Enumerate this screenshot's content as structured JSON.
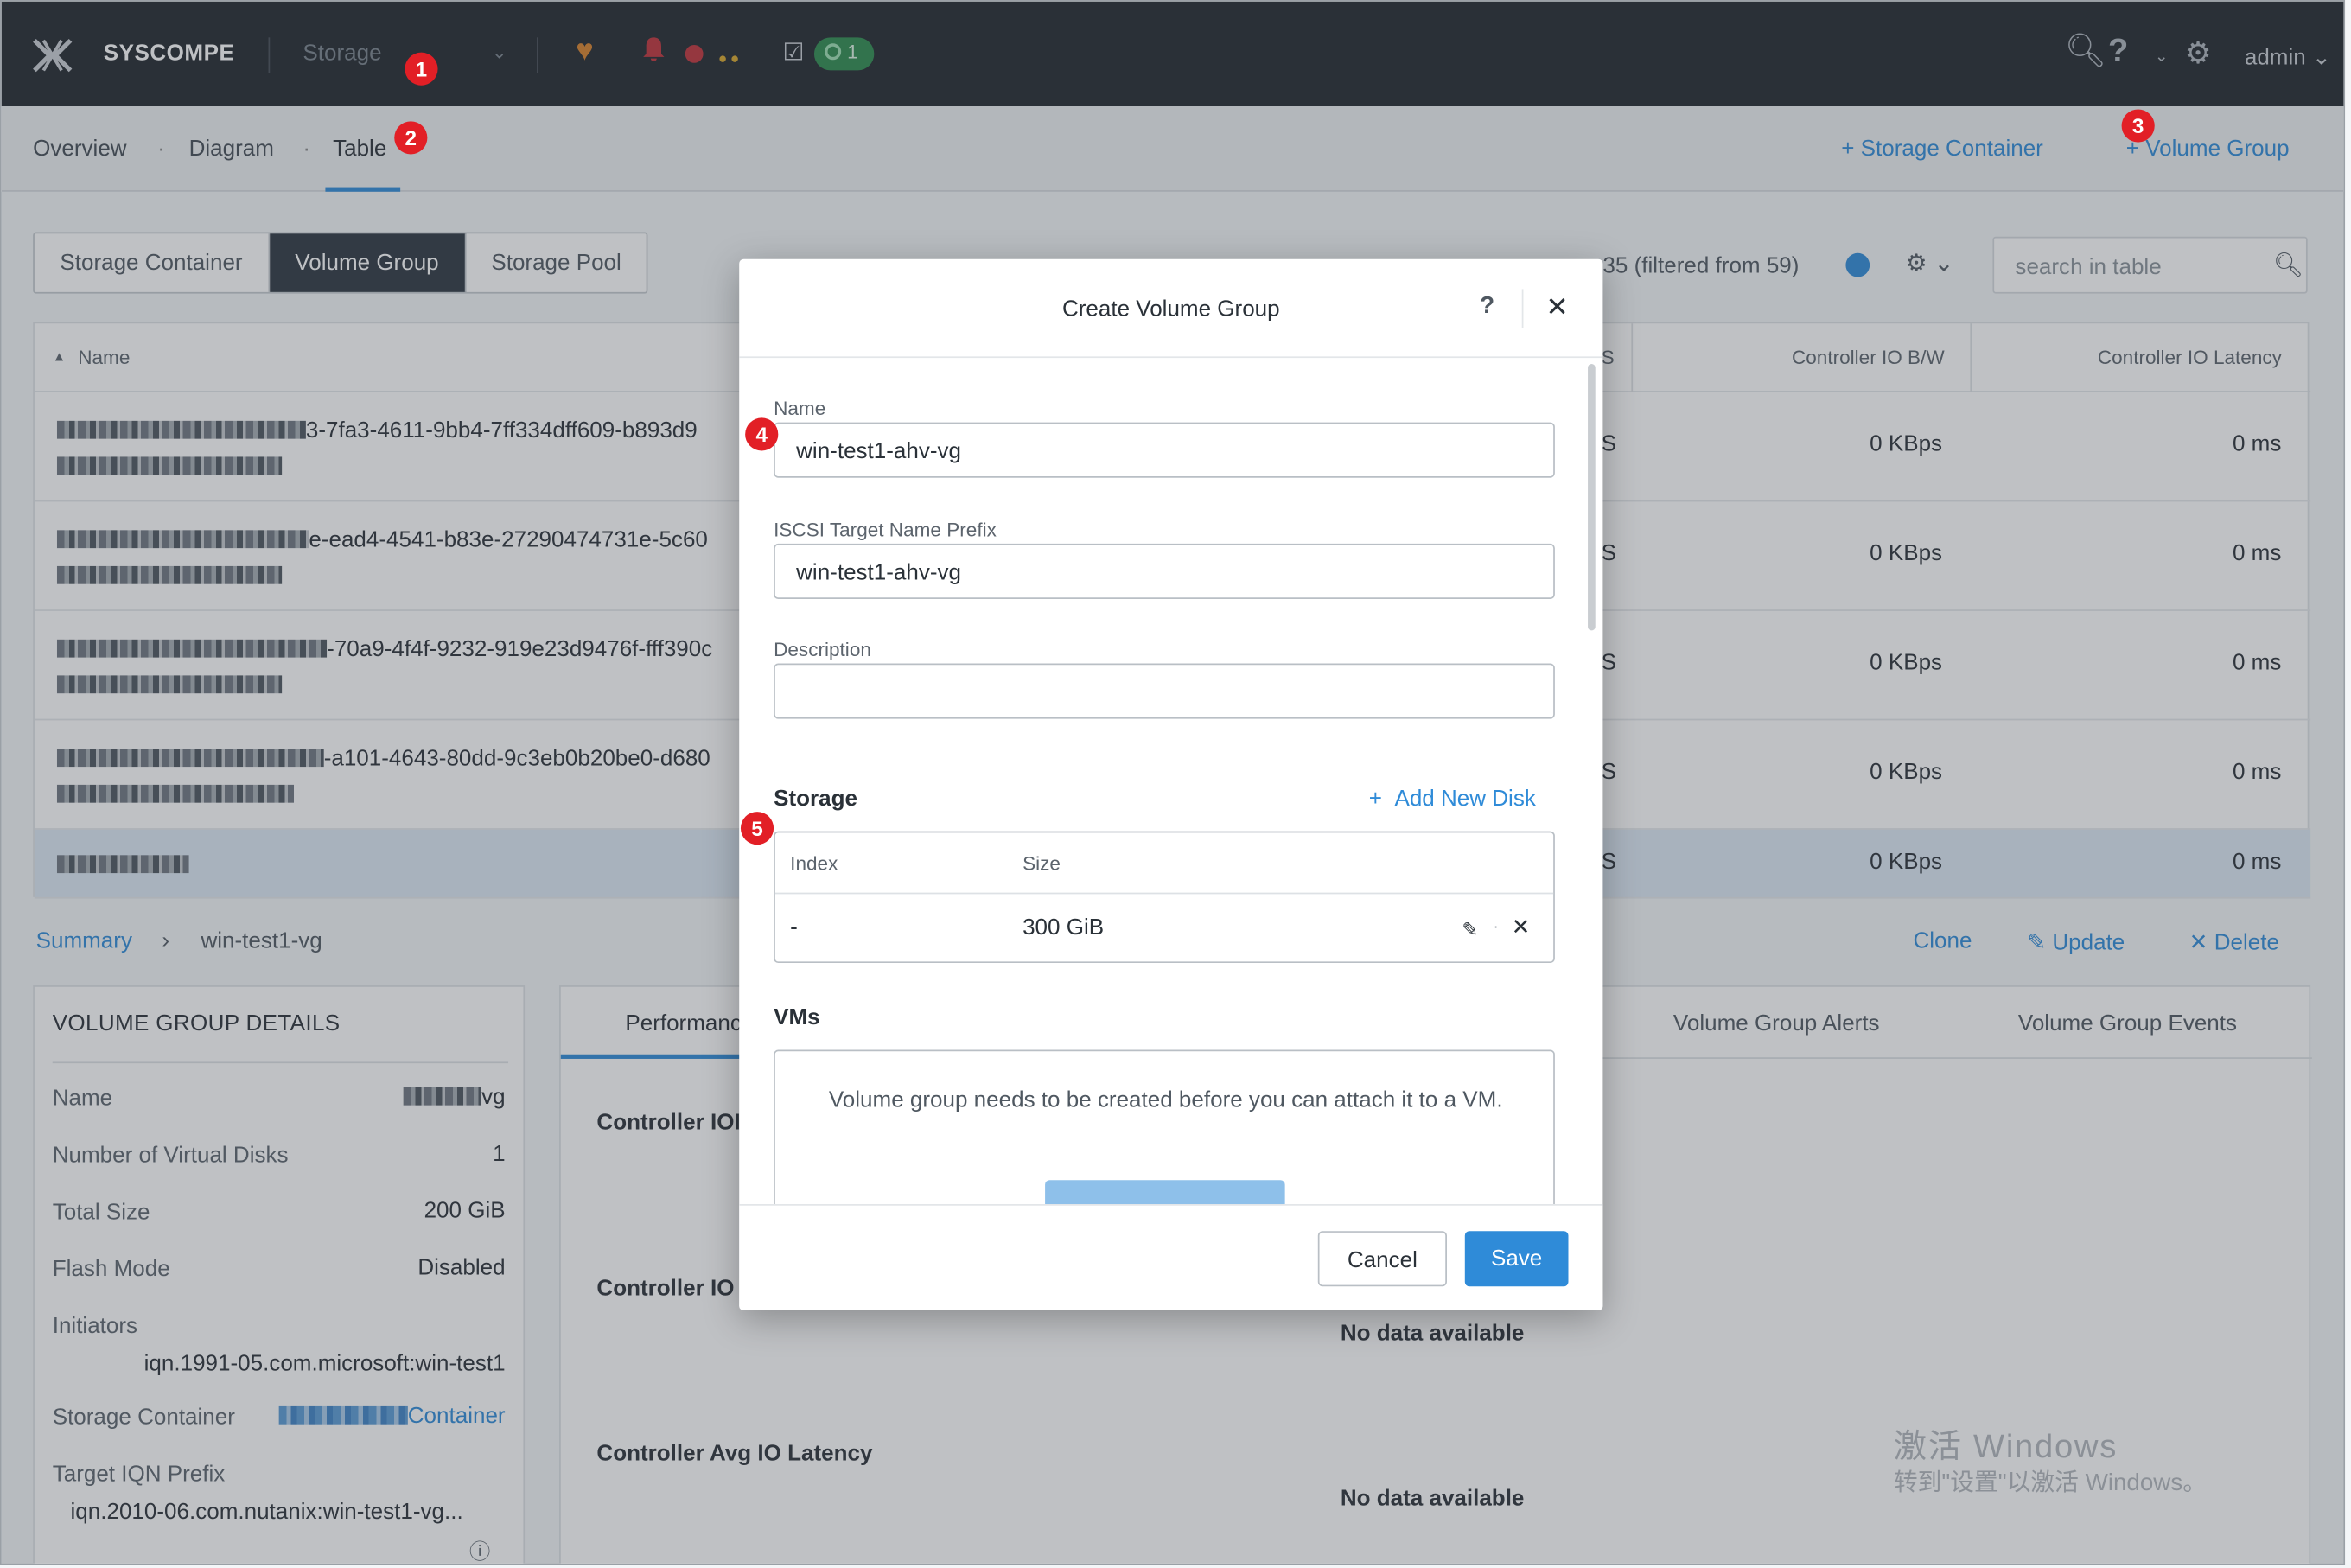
{
  "topbar": {
    "brand": "SYSCOMPE",
    "module": "Storage",
    "task_count": "1",
    "user": "admin"
  },
  "subnav": {
    "items": [
      "Overview",
      "Diagram",
      "Table"
    ],
    "separator": "·",
    "add_container": "Storage Container",
    "add_vg": "Volume Group"
  },
  "badges": [
    "1",
    "2",
    "3",
    "4",
    "5"
  ],
  "tabs": [
    "Storage Container",
    "Volume Group",
    "Storage Pool"
  ],
  "table_info": "35 (filtered from 59)",
  "search_placeholder": "search in table",
  "table": {
    "col_name": "Name",
    "col_partial": "S",
    "col_bw": "Controller IO B/W",
    "col_latency": "Controller IO Latency",
    "rows": [
      {
        "name": "3-7fa3-4611-9bb4-7ff334dff609-b893d9",
        "bw": "0 KBps",
        "lat": "0 ms"
      },
      {
        "name": "e-ead4-4541-b83e-27290474731e-5c60",
        "bw": "0 KBps",
        "lat": "0 ms"
      },
      {
        "name": "-70a9-4f4f-9232-919e23d9476f-fff390c",
        "bw": "0 KBps",
        "lat": "0 ms"
      },
      {
        "name": "-a101-4643-80dd-9c3eb0b20be0-d680",
        "bw": "0 KBps",
        "lat": "0 ms"
      },
      {
        "name": "",
        "bw": "0 KBps",
        "lat": "0 ms"
      }
    ]
  },
  "breadcrumb": {
    "root": "Summary",
    "sep": "›",
    "current": "win-test1-vg"
  },
  "actions": {
    "clone": "Clone",
    "update": "Update",
    "delete": "Delete"
  },
  "details": {
    "title": "VOLUME GROUP DETAILS",
    "name_key": "Name",
    "name_val": "vg",
    "disks_key": "Number of Virtual Disks",
    "disks_val": "1",
    "size_key": "Total Size",
    "size_val": "200 GiB",
    "flash_key": "Flash Mode",
    "flash_val": "Disabled",
    "init_key": "Initiators",
    "init_val": "iqn.1991-05.com.microsoft:win-test1",
    "sc_key": "Storage Container",
    "sc_val": "Container",
    "iqn_key": "Target IQN Prefix",
    "iqn_val": "iqn.2010-06.com.nutanix:win-test1-vg..."
  },
  "perf": {
    "tab_perf": "Performanc",
    "tab_alerts": "Volume Group Alerts",
    "tab_events": "Volume Group Events",
    "m1": "Controller IOI",
    "m2": "Controller IO",
    "m3": "Controller Avg IO Latency",
    "nodata": "No data available"
  },
  "watermark": {
    "line1": "激活 Windows",
    "line2": "转到\"设置\"以激活 Windows。"
  },
  "modal": {
    "title": "Create Volume Group",
    "help": "?",
    "name_label": "Name",
    "name_value": "win-test1-ahv-vg",
    "iscsi_label": "ISCSI Target Name Prefix",
    "iscsi_value": "win-test1-ahv-vg",
    "desc_label": "Description",
    "desc_value": "",
    "storage_title": "Storage",
    "add_disk": "Add New Disk",
    "disk_col_index": "Index",
    "disk_col_size": "Size",
    "disk_index": "-",
    "disk_size": "300 GiB",
    "vms_title": "VMs",
    "vms_msg": "Volume group needs to be created before you can attach it to a VM.",
    "cancel": "Cancel",
    "save": "Save"
  },
  "colors": {
    "accent": "#2f8bd8",
    "topbar": "#22272e",
    "badge": "#e21f26",
    "active_tab": "#2e3640"
  }
}
